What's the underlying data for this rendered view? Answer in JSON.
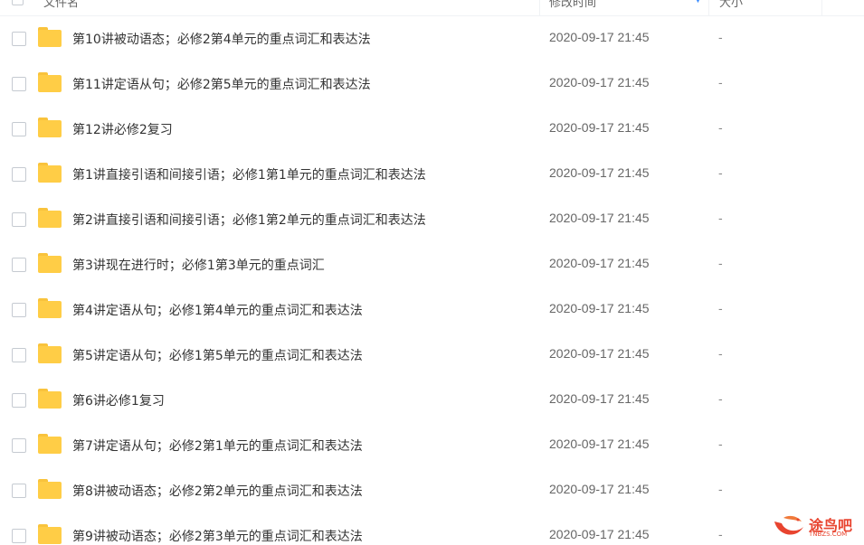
{
  "header": {
    "name_label": "文件名",
    "time_label": "修改时间",
    "size_label": "大小"
  },
  "files": [
    {
      "name": "第10讲被动语态；必修2第4单元的重点词汇和表达法",
      "time": "2020-09-17 21:45",
      "size": "-"
    },
    {
      "name": "第11讲定语从句；必修2第5单元的重点词汇和表达法",
      "time": "2020-09-17 21:45",
      "size": "-"
    },
    {
      "name": "第12讲必修2复习",
      "time": "2020-09-17 21:45",
      "size": "-"
    },
    {
      "name": "第1讲直接引语和间接引语；必修1第1单元的重点词汇和表达法",
      "time": "2020-09-17 21:45",
      "size": "-"
    },
    {
      "name": "第2讲直接引语和间接引语；必修1第2单元的重点词汇和表达法",
      "time": "2020-09-17 21:45",
      "size": "-"
    },
    {
      "name": "第3讲现在进行时；必修1第3单元的重点词汇",
      "time": "2020-09-17 21:45",
      "size": "-"
    },
    {
      "name": "第4讲定语从句；必修1第4单元的重点词汇和表达法",
      "time": "2020-09-17 21:45",
      "size": "-"
    },
    {
      "name": "第5讲定语从句；必修1第5单元的重点词汇和表达法",
      "time": "2020-09-17 21:45",
      "size": "-"
    },
    {
      "name": "第6讲必修1复习",
      "time": "2020-09-17 21:45",
      "size": "-"
    },
    {
      "name": "第7讲定语从句；必修2第1单元的重点词汇和表达法",
      "time": "2020-09-17 21:45",
      "size": "-"
    },
    {
      "name": "第8讲被动语态；必修2第2单元的重点词汇和表达法",
      "time": "2020-09-17 21:45",
      "size": "-"
    },
    {
      "name": "第9讲被动语态；必修2第3单元的重点词汇和表达法",
      "time": "2020-09-17 21:45",
      "size": "-"
    }
  ],
  "icons": {
    "folder": "folder-icon",
    "checkbox": "checkbox",
    "sort": "sort-down-icon"
  },
  "colors": {
    "folder": "#ffcd46",
    "accent": "#3b8cff",
    "watermark": "#e8442f"
  },
  "watermark": {
    "text": "途鸟吧",
    "sub": "TNBZS.COM"
  }
}
